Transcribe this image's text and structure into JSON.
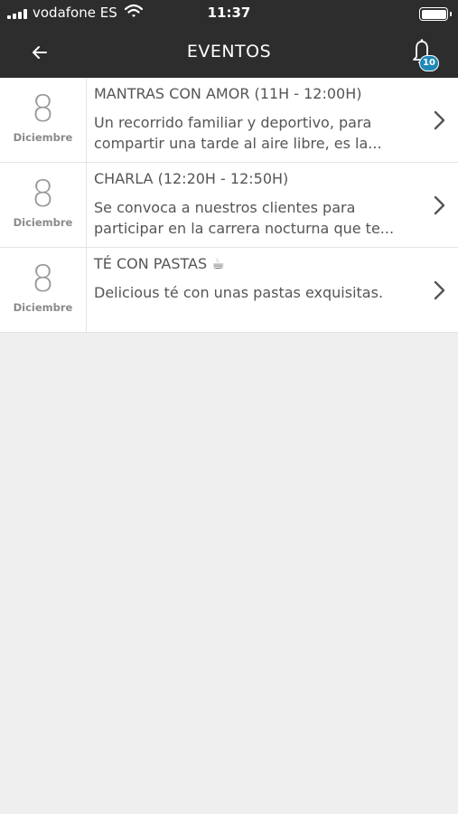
{
  "status_bar": {
    "carrier": "vodafone ES",
    "time": "11:37"
  },
  "header": {
    "title": "EVENTOS",
    "notification_count": "10"
  },
  "events": [
    {
      "day": "8",
      "month": "Diciembre",
      "title": "MANTRAS CON AMOR (11H -  12:00H)",
      "description": "Un recorrido familiar y deportivo, para compartir una tarde al aire libre, es la..."
    },
    {
      "day": "8",
      "month": "Diciembre",
      "title": "CHARLA (12:20H - 12:50H)",
      "description": "Se convoca a nuestros clientes para participar en la carrera nocturna que te..."
    },
    {
      "day": "8",
      "month": "Diciembre",
      "title": "TÉ CON PASTAS ☕",
      "description": "Delicious té con unas pastas exquisitas."
    }
  ],
  "colors": {
    "header_bg": "#2d2d2d",
    "badge": "#1e88b8",
    "page_bg": "#efefef"
  }
}
